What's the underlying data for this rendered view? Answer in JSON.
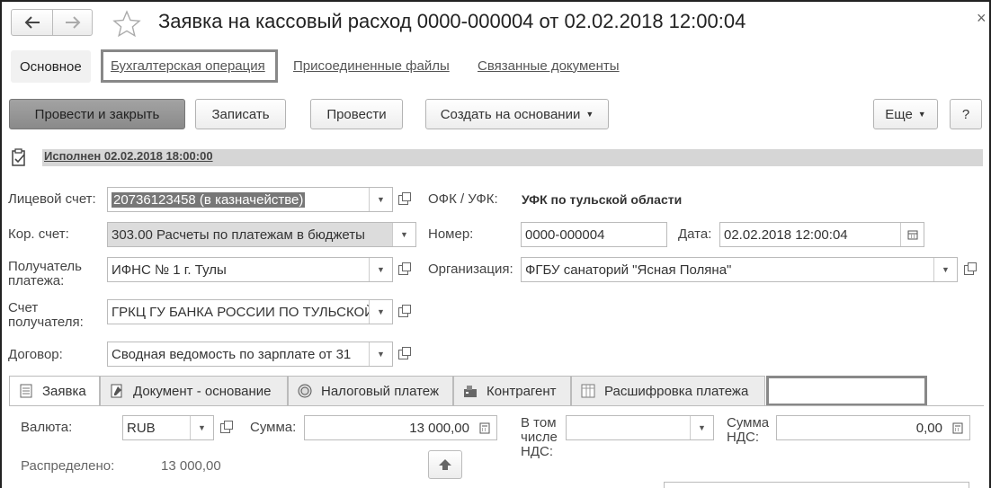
{
  "window": {
    "title": "Заявка на кассовый расход 0000-000004 от 02.02.2018 12:00:04",
    "close_label": "×",
    "back_icon": "arrow-left-icon",
    "forward_icon": "arrow-right-icon",
    "favorite_icon": "star-icon"
  },
  "sections": {
    "main": "Основное",
    "accounting": "Бухгалтерская операция",
    "files": "Присоединенные файлы",
    "related": "Связанные документы"
  },
  "toolbar": {
    "post_close": "Провести и закрыть",
    "save": "Записать",
    "post": "Провести",
    "create_based": "Создать на основании",
    "more": "Еще",
    "help": "?"
  },
  "status": {
    "text": "Исполнен 02.02.2018 18:00:00"
  },
  "form": {
    "account_label": "Лицевой счет:",
    "account_value": "20736123458 (в казначействе)",
    "corr_label": "Кор. счет:",
    "corr_value": "303.00 Расчеты по платежам в бюджеты",
    "recipient_label": "Получатель платежа:",
    "recipient_value": "ИФНС № 1 г. Тулы",
    "recipient_acc_label": "Счет получателя:",
    "recipient_acc_value": "ГРКЦ ГУ БАНКА РОССИИ ПО ТУЛЬСКОЙ",
    "contract_label": "Договор:",
    "contract_value": "Сводная ведомость по зарплате от 31",
    "ofk_label": "ОФК / УФК:",
    "ofk_value": "УФК по тульской области",
    "number_label": "Номер:",
    "number_value": "0000-000004",
    "date_label": "Дата:",
    "date_value": "02.02.2018 12:00:04",
    "org_label": "Организация:",
    "org_value": "ФГБУ санаторий \"Ясная Поляна\""
  },
  "tabs": [
    {
      "label": "Заявка",
      "icon": "document-icon"
    },
    {
      "label": "Документ - основание",
      "icon": "document-edit-icon"
    },
    {
      "label": "Налоговый платеж",
      "icon": "coin-icon"
    },
    {
      "label": "Контрагент",
      "icon": "contractor-icon"
    },
    {
      "label": "Расшифровка платежа",
      "icon": "table-icon"
    }
  ],
  "request_tab": {
    "currency_label": "Валюта:",
    "currency_value": "RUB",
    "sum_label": "Сумма:",
    "sum_value": "13 000,00",
    "vat_incl_label": "В том числе НДС:",
    "vat_incl_value": "",
    "vat_sum_label": "Сумма НДС:",
    "vat_sum_value": "0,00",
    "distributed_label": "Распределено:",
    "distributed_value": "13 000,00"
  }
}
